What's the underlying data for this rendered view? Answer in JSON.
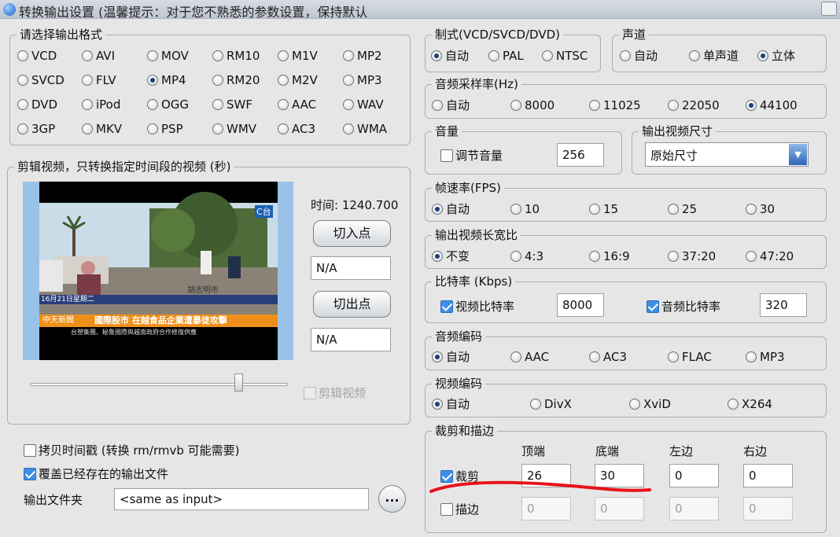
{
  "window": {
    "title": "转换输出设置 (温馨提示：对于您不熟悉的参数设置，保持默认"
  },
  "output_format": {
    "legend": "请选择输出格式",
    "options": [
      "VCD",
      "AVI",
      "MOV",
      "RM10",
      "M1V",
      "MP2",
      "SVCD",
      "FLV",
      "MP4",
      "RM20",
      "M2V",
      "MP3",
      "DVD",
      "iPod",
      "OGG",
      "SWF",
      "AAC",
      "WAV",
      "3GP",
      "MKV",
      "PSP",
      "WMV",
      "AC3",
      "WMA"
    ],
    "selected": "MP4"
  },
  "clip": {
    "legend": "剪辑视频，只转换指定时间段的视频 (秒)",
    "time": "时间: 1240.700",
    "start_button": "切入点",
    "start_value": "N/A",
    "end_button": "切出点",
    "end_value": "N/A",
    "enable_label": "剪辑视频",
    "slider_fraction": 0.81,
    "video": {
      "channel_logo": "C台",
      "date_tag": "16月21日星期二",
      "logo_text": "中天新聞",
      "ticker": "國際股市  在越食品企業遭暴徒攻擊",
      "subticker": "台塑集團、秘鲁國際與越南政府合作修復供應",
      "sign": "胡志明市"
    }
  },
  "options": {
    "copy_timestamp": "拷贝时间戳 (转换 rm/rmvb 可能需要)",
    "overwrite": "覆盖已经存在的输出文件",
    "output_folder_label": "输出文件夹",
    "output_folder_value": "<same as input>",
    "browse_button": "..."
  },
  "standard": {
    "legend": "制式(VCD/SVCD/DVD)",
    "options": [
      "自动",
      "PAL",
      "NTSC"
    ],
    "selected": "自动"
  },
  "channels": {
    "legend": "声道",
    "options": [
      "自动",
      "单声道",
      "立体"
    ],
    "selected": "立体"
  },
  "sample_rate": {
    "legend": "音频采样率(Hz)",
    "options": [
      "自动",
      "8000",
      "11025",
      "22050",
      "44100"
    ],
    "selected": "44100"
  },
  "volume": {
    "legend": "音量",
    "adjust_label": "调节音量",
    "value": "256"
  },
  "output_size": {
    "legend": "输出视频尺寸",
    "value": "原始尺寸"
  },
  "fps": {
    "legend": "帧速率(FPS)",
    "options": [
      "自动",
      "10",
      "15",
      "25",
      "30"
    ],
    "selected": "自动"
  },
  "aspect": {
    "legend": "输出视频长宽比",
    "options": [
      "不变",
      "4:3",
      "16:9",
      "37:20",
      "47:20"
    ],
    "selected": "不变"
  },
  "bitrate": {
    "legend": "比特率 (Kbps)",
    "video_label": "视频比特率",
    "video_value": "8000",
    "audio_label": "音频比特率",
    "audio_value": "320"
  },
  "audio_codec": {
    "legend": "音频编码",
    "options": [
      "自动",
      "AAC",
      "AC3",
      "FLAC",
      "MP3"
    ],
    "selected": "自动"
  },
  "video_codec": {
    "legend": "视频编码",
    "options": [
      "自动",
      "DivX",
      "XviD",
      "X264"
    ],
    "selected": "自动"
  },
  "crop": {
    "legend": "裁剪和描边",
    "headers": [
      "顶端",
      "底端",
      "左边",
      "右边"
    ],
    "crop_label": "裁剪",
    "crop_values": [
      "26",
      "30",
      "0",
      "0"
    ],
    "pad_label": "描边",
    "pad_values": [
      "0",
      "0",
      "0",
      "0"
    ]
  },
  "colors": {
    "accent": "#3d8ee6",
    "annotation": "#e8121b",
    "background": "#e6e6e6"
  }
}
